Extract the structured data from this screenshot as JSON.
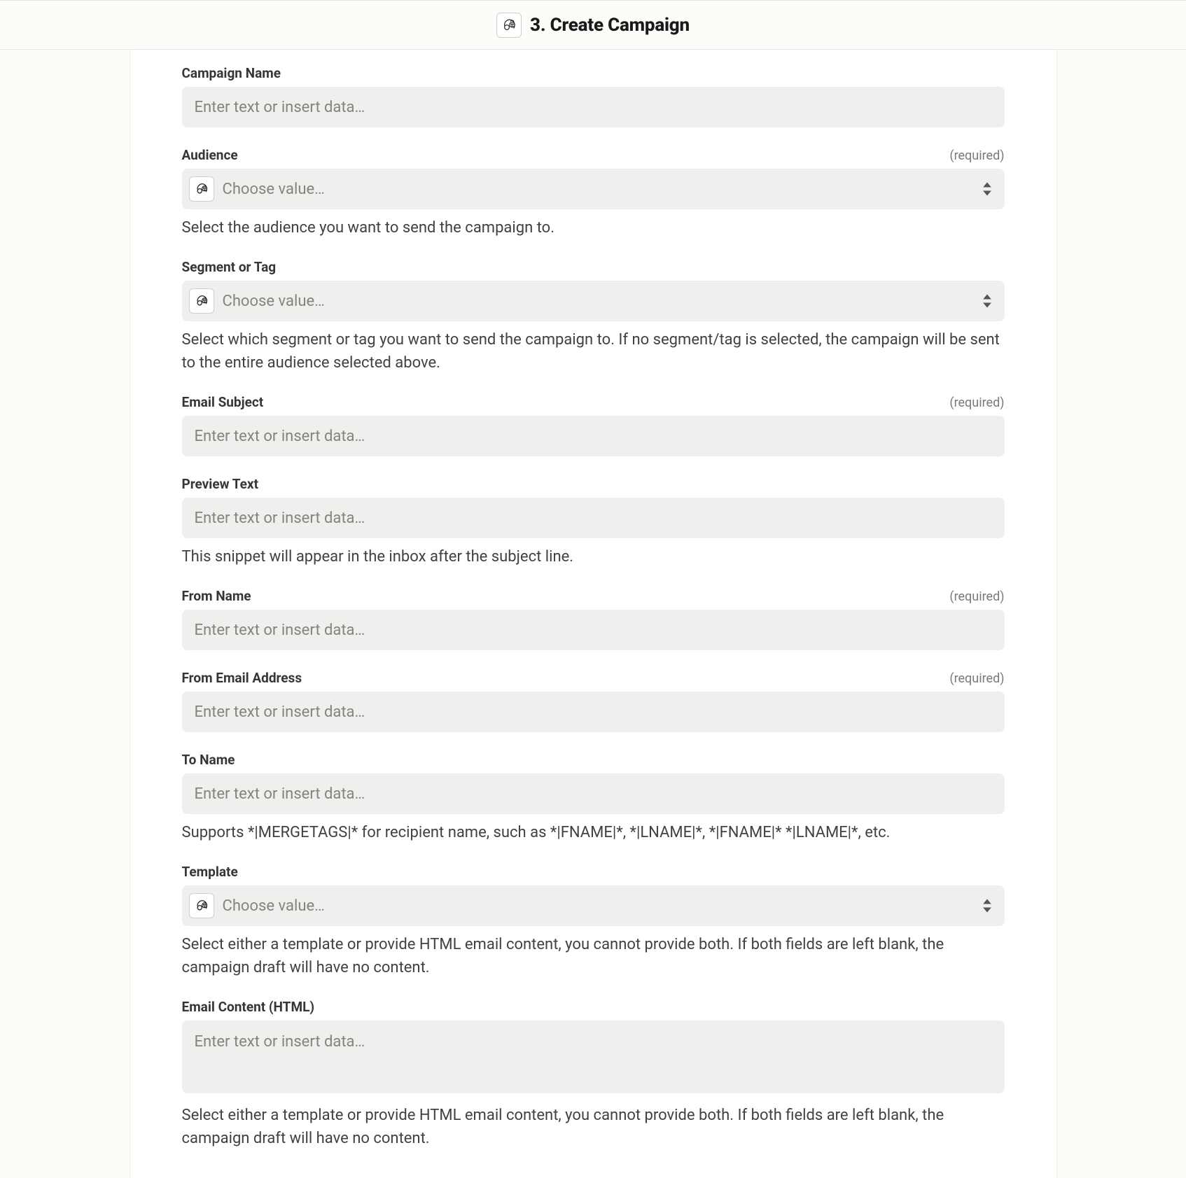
{
  "header": {
    "title": "3. Create Campaign"
  },
  "common": {
    "required_label": "(required)",
    "text_placeholder": "Enter text or insert data…",
    "choose_value": "Choose value…"
  },
  "fields": {
    "campaign_name": {
      "label": "Campaign Name"
    },
    "audience": {
      "label": "Audience",
      "helper": "Select the audience you want to send the campaign to."
    },
    "segment": {
      "label": "Segment or Tag",
      "helper": "Select which segment or tag you want to send the campaign to. If no segment/tag is selected, the campaign will be sent to the entire audience selected above."
    },
    "email_subject": {
      "label": "Email Subject"
    },
    "preview_text": {
      "label": "Preview Text",
      "helper": "This snippet will appear in the inbox after the subject line."
    },
    "from_name": {
      "label": "From Name"
    },
    "from_email": {
      "label": "From Email Address"
    },
    "to_name": {
      "label": "To Name",
      "helper": "Supports *|MERGETAGS|* for recipient name, such as *|FNAME|*, *|LNAME|*, *|FNAME|* *|LNAME|*, etc."
    },
    "template": {
      "label": "Template",
      "helper": "Select either a template or provide HTML email content, you cannot provide both. If both fields are left blank, the campaign draft will have no content."
    },
    "email_content": {
      "label": "Email Content (HTML)",
      "helper": "Select either a template or provide HTML email content, you cannot provide both. If both fields are left blank, the campaign draft will have no content."
    }
  }
}
